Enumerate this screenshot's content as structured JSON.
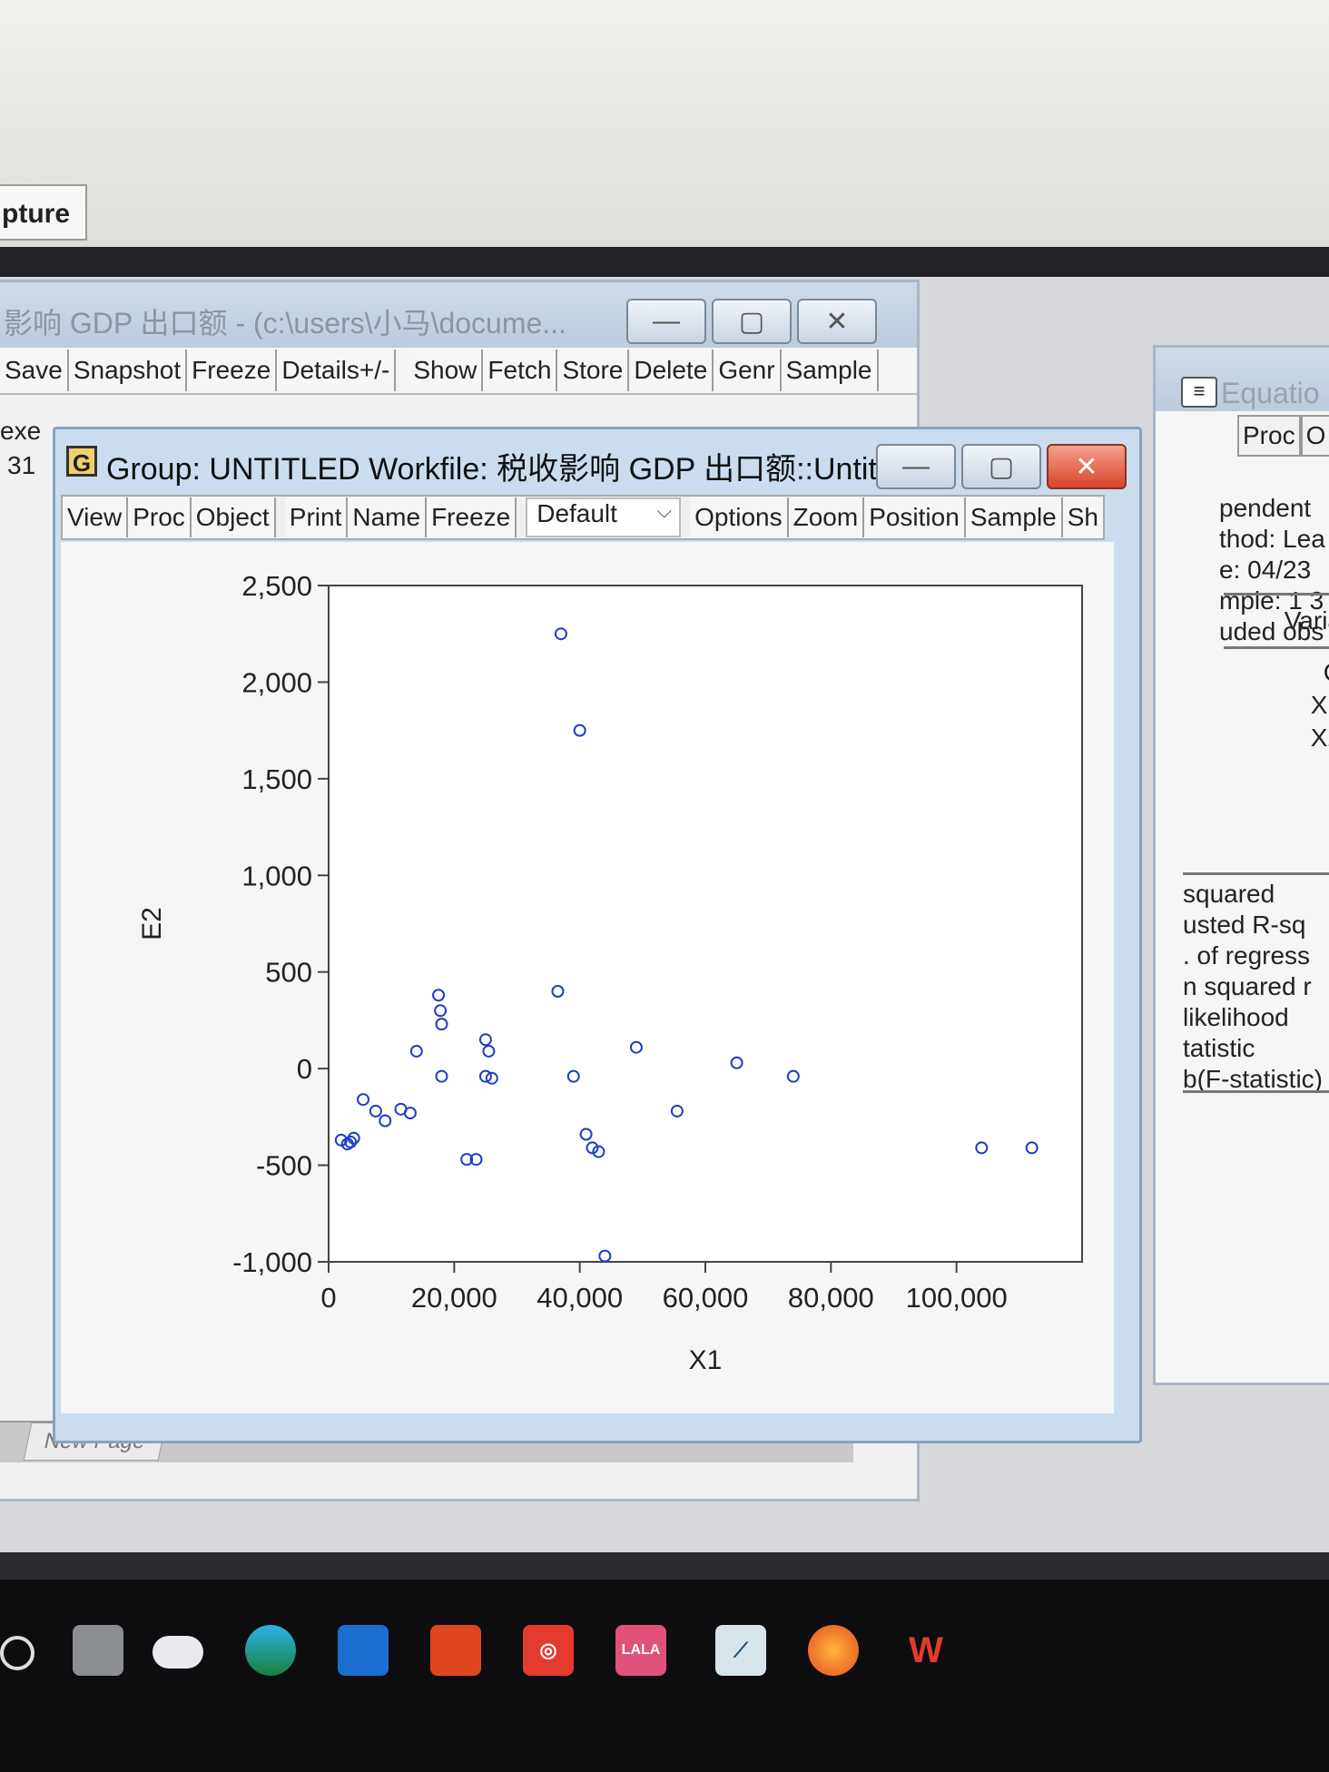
{
  "capture_tab": {
    "label": "pture"
  },
  "workfile": {
    "title": "影响 GDP 出口额 - (c:\\users\\小马\\docume...",
    "toolbar": [
      "Save",
      "Snapshot",
      "Freeze",
      "Details+/-",
      "Show",
      "Fetch",
      "Store",
      "Delete",
      "Genr",
      "Sample"
    ],
    "rows": [
      "exe",
      "31"
    ],
    "new_page_tab": "New Page"
  },
  "equation": {
    "title": "Equatio",
    "toolbar": [
      "Proc",
      "O"
    ],
    "header_lines": [
      "pendent",
      "thod: Lea",
      "e: 04/23",
      "mple: 1 3",
      "uded obs"
    ],
    "variable_header": "Varia",
    "variables": [
      "C",
      "X1",
      "X2"
    ],
    "stats": [
      "squared",
      "usted R-sq",
      ". of regress",
      "n squared r",
      "likelihood",
      "tatistic",
      "b(F-statistic)"
    ]
  },
  "group": {
    "icon_letter": "G",
    "title": "Group: UNTITLED   Workfile: 税收影响 GDP 出口额::Untitl...",
    "toolbar_left": [
      "View",
      "Proc",
      "Object",
      "Print",
      "Name",
      "Freeze"
    ],
    "dropdown_value": "Default",
    "toolbar_right": [
      "Options",
      "Zoom",
      "Position",
      "Sample",
      "Sh"
    ]
  },
  "window_buttons": {
    "minimize": "—",
    "restore": "▢",
    "close": "✕"
  },
  "chart_data": {
    "type": "scatter",
    "xlabel": "X1",
    "ylabel": "E2",
    "xlim": [
      0,
      120000
    ],
    "ylim": [
      -1000,
      2500
    ],
    "x_ticks": [
      0,
      20000,
      40000,
      60000,
      80000,
      100000
    ],
    "x_tick_labels": [
      "0",
      "20,000",
      "40,000",
      "60,000",
      "80,000",
      "100,000"
    ],
    "y_ticks": [
      2500,
      2000,
      1500,
      1000,
      500,
      0,
      -500,
      -1000
    ],
    "y_tick_labels": [
      "2,500",
      "2,000",
      "1,500",
      "1,000",
      "500",
      "0",
      "-500",
      "-1,000"
    ],
    "marker_color": "#1f3fbf",
    "points": [
      {
        "x": 2000,
        "y": -370
      },
      {
        "x": 3000,
        "y": -390
      },
      {
        "x": 4000,
        "y": -360
      },
      {
        "x": 3500,
        "y": -380
      },
      {
        "x": 5500,
        "y": -160
      },
      {
        "x": 7500,
        "y": -220
      },
      {
        "x": 9000,
        "y": -270
      },
      {
        "x": 11500,
        "y": -210
      },
      {
        "x": 13000,
        "y": -230
      },
      {
        "x": 14000,
        "y": 90
      },
      {
        "x": 17500,
        "y": 380
      },
      {
        "x": 17800,
        "y": 300
      },
      {
        "x": 18000,
        "y": 230
      },
      {
        "x": 18000,
        "y": -40
      },
      {
        "x": 22000,
        "y": -470
      },
      {
        "x": 23500,
        "y": -470
      },
      {
        "x": 25000,
        "y": 150
      },
      {
        "x": 25500,
        "y": 90
      },
      {
        "x": 25000,
        "y": -40
      },
      {
        "x": 26000,
        "y": -50
      },
      {
        "x": 36500,
        "y": 400
      },
      {
        "x": 37000,
        "y": 2250
      },
      {
        "x": 39000,
        "y": -40
      },
      {
        "x": 40000,
        "y": 1750
      },
      {
        "x": 41000,
        "y": -340
      },
      {
        "x": 42000,
        "y": -410
      },
      {
        "x": 43000,
        "y": -430
      },
      {
        "x": 44000,
        "y": -970
      },
      {
        "x": 49000,
        "y": 110
      },
      {
        "x": 55500,
        "y": -220
      },
      {
        "x": 65000,
        "y": 30
      },
      {
        "x": 74000,
        "y": -40
      },
      {
        "x": 104000,
        "y": -410
      },
      {
        "x": 112000,
        "y": -410
      }
    ]
  },
  "taskbar": {
    "icons": [
      "task-view-icon",
      "file-explorer-icon",
      "onedrive-icon",
      "edge-icon",
      "mail-icon",
      "office-icon",
      "netease-music-icon",
      "app-icon",
      "eviews-icon",
      "firefox-icon",
      "wps-icon"
    ],
    "app_icon_label": "LALA"
  }
}
